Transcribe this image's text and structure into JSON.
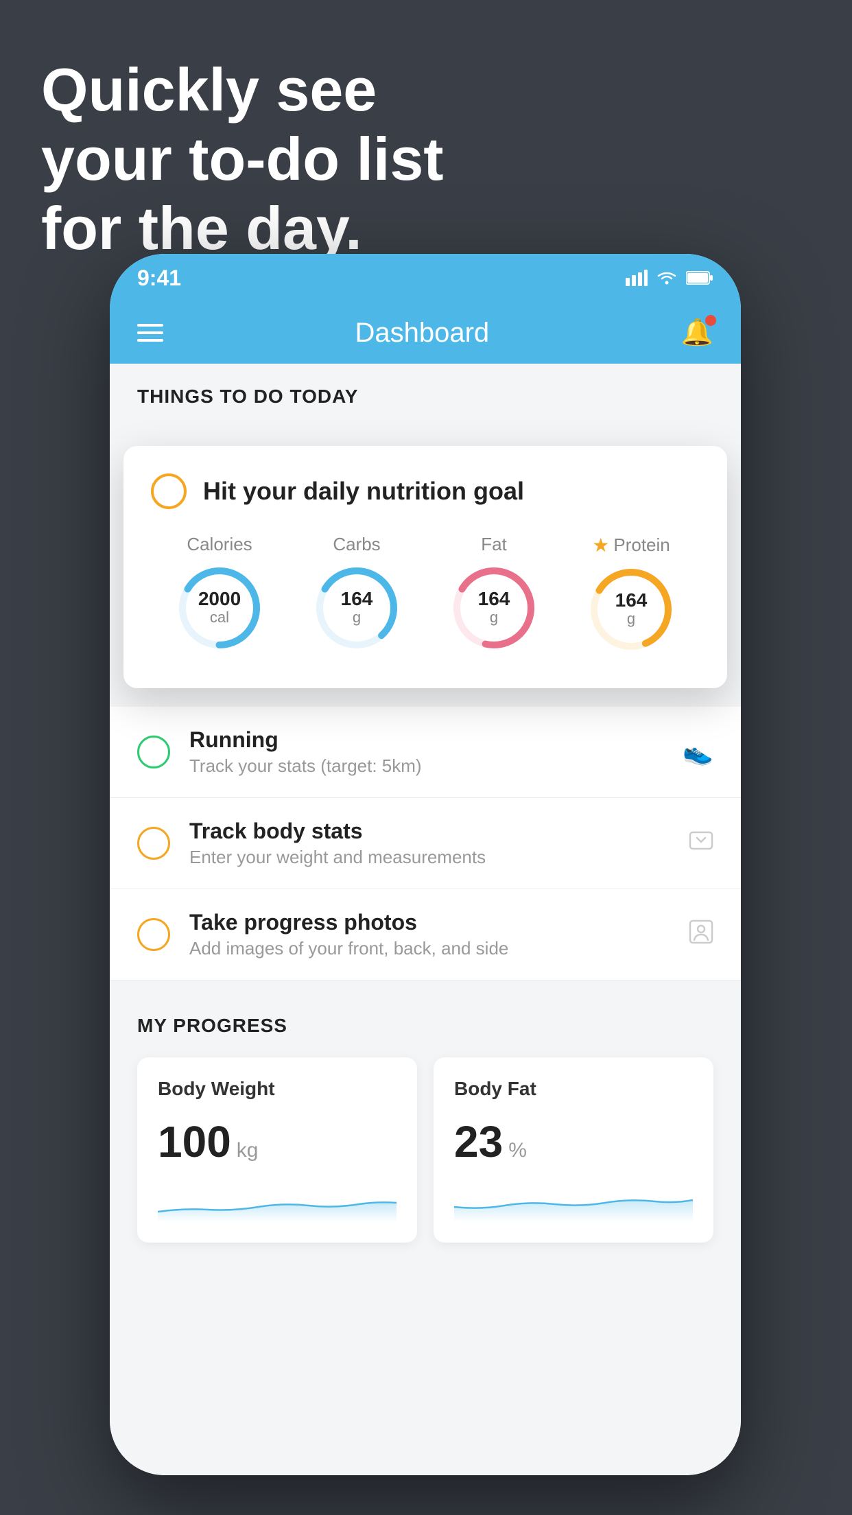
{
  "background": {
    "color": "#3a3f47"
  },
  "headline": {
    "line1": "Quickly see",
    "line2": "your to-do list",
    "line3": "for the day."
  },
  "phone": {
    "statusBar": {
      "time": "9:41",
      "icons": [
        "signal",
        "wifi",
        "battery"
      ]
    },
    "navBar": {
      "title": "Dashboard"
    },
    "sections": {
      "thingsToDo": {
        "title": "THINGS TO DO TODAY"
      }
    },
    "nutritionCard": {
      "checkIcon": "circle-unchecked",
      "title": "Hit your daily nutrition goal",
      "circles": [
        {
          "label": "Calories",
          "value": "2000",
          "unit": "cal",
          "color": "#4db8e8",
          "progress": 65
        },
        {
          "label": "Carbs",
          "value": "164",
          "unit": "g",
          "color": "#4db8e8",
          "progress": 55
        },
        {
          "label": "Fat",
          "value": "164",
          "unit": "g",
          "color": "#e8708a",
          "progress": 70
        },
        {
          "label": "Protein",
          "value": "164",
          "unit": "g",
          "color": "#f5a623",
          "progress": 60,
          "starred": true
        }
      ]
    },
    "todoItems": [
      {
        "name": "Running",
        "sub": "Track your stats (target: 5km)",
        "circleColor": "green",
        "icon": "shoe"
      },
      {
        "name": "Track body stats",
        "sub": "Enter your weight and measurements",
        "circleColor": "yellow",
        "icon": "scale"
      },
      {
        "name": "Take progress photos",
        "sub": "Add images of your front, back, and side",
        "circleColor": "yellow",
        "icon": "person"
      }
    ],
    "progress": {
      "title": "MY PROGRESS",
      "cards": [
        {
          "title": "Body Weight",
          "value": "100",
          "unit": "kg"
        },
        {
          "title": "Body Fat",
          "value": "23",
          "unit": "%"
        }
      ]
    }
  }
}
